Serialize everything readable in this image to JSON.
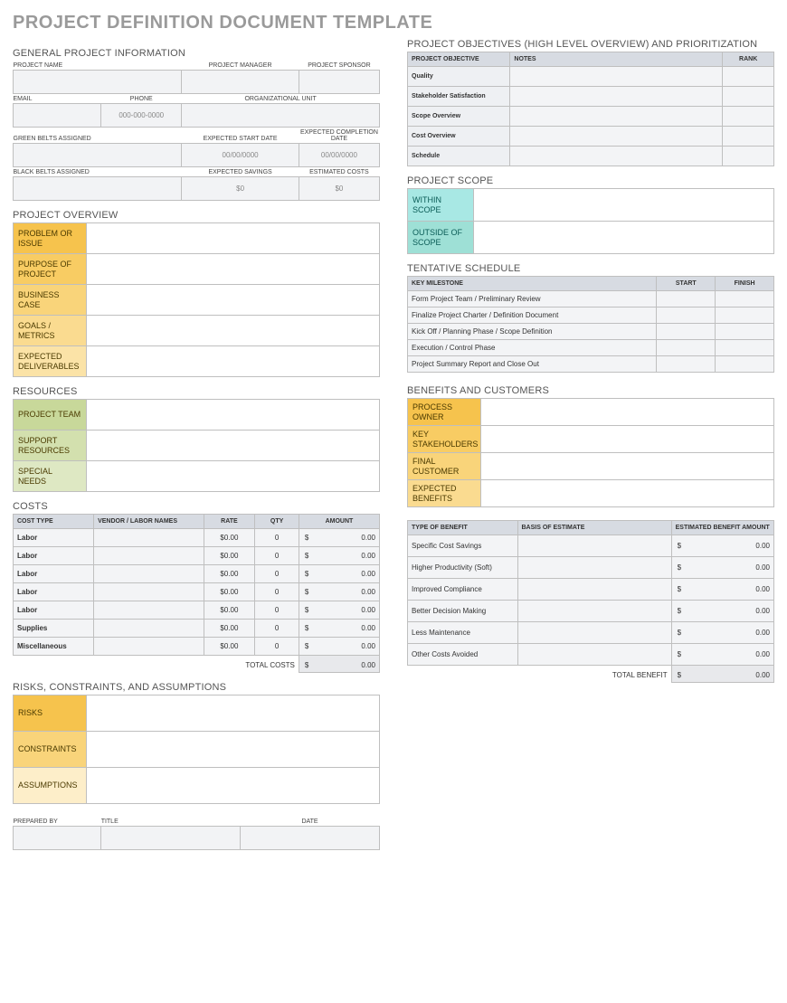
{
  "title": "PROJECT DEFINITION DOCUMENT TEMPLATE",
  "left": {
    "general": {
      "heading": "GENERAL PROJECT INFORMATION",
      "labels": {
        "project_name": "PROJECT NAME",
        "project_manager": "PROJECT MANAGER",
        "project_sponsor": "PROJECT SPONSOR",
        "email": "EMAIL",
        "phone": "PHONE",
        "org_unit": "ORGANIZATIONAL UNIT",
        "green_belts": "GREEN BELTS ASSIGNED",
        "exp_start": "EXPECTED START DATE",
        "exp_end": "EXPECTED COMPLETION DATE",
        "black_belts": "BLACK BELTS ASSIGNED",
        "exp_savings": "EXPECTED SAVINGS",
        "est_costs": "ESTIMATED COSTS"
      },
      "placeholders": {
        "phone": "000-000-0000",
        "date": "00/00/0000",
        "money": "$0"
      }
    },
    "overview": {
      "heading": "PROJECT OVERVIEW",
      "rows": [
        "PROBLEM OR ISSUE",
        "PURPOSE OF PROJECT",
        "BUSINESS CASE",
        "GOALS / METRICS",
        "EXPECTED DELIVERABLES"
      ]
    },
    "resources": {
      "heading": "RESOURCES",
      "rows": [
        "PROJECT TEAM",
        "SUPPORT RESOURCES",
        "SPECIAL NEEDS"
      ]
    },
    "costs": {
      "heading": "COSTS",
      "headers": [
        "COST TYPE",
        "VENDOR / LABOR NAMES",
        "RATE",
        "QTY",
        "AMOUNT"
      ],
      "rows": [
        {
          "type": "Labor",
          "rate": "$0.00",
          "qty": "0",
          "amt": "0.00"
        },
        {
          "type": "Labor",
          "rate": "$0.00",
          "qty": "0",
          "amt": "0.00"
        },
        {
          "type": "Labor",
          "rate": "$0.00",
          "qty": "0",
          "amt": "0.00"
        },
        {
          "type": "Labor",
          "rate": "$0.00",
          "qty": "0",
          "amt": "0.00"
        },
        {
          "type": "Labor",
          "rate": "$0.00",
          "qty": "0",
          "amt": "0.00"
        },
        {
          "type": "Supplies",
          "rate": "$0.00",
          "qty": "0",
          "amt": "0.00"
        },
        {
          "type": "Miscellaneous",
          "rate": "$0.00",
          "qty": "0",
          "amt": "0.00"
        }
      ],
      "total_label": "TOTAL COSTS",
      "total": "0.00",
      "cur": "$"
    },
    "risks": {
      "heading": "RISKS, CONSTRAINTS, AND ASSUMPTIONS",
      "rows": [
        "RISKS",
        "CONSTRAINTS",
        "ASSUMPTIONS"
      ]
    },
    "footer": {
      "labels": {
        "prepared": "PREPARED BY",
        "title": "TITLE",
        "date": "DATE"
      }
    }
  },
  "right": {
    "objectives": {
      "heading": "PROJECT OBJECTIVES (HIGH LEVEL OVERVIEW) AND PRIORITIZATION",
      "headers": [
        "PROJECT OBJECTIVE",
        "NOTES",
        "RANK"
      ],
      "rows": [
        "Quality",
        "Stakeholder Satisfaction",
        "Scope Overview",
        "Cost Overview",
        "Schedule"
      ]
    },
    "scope": {
      "heading": "PROJECT SCOPE",
      "rows": [
        "WITHIN SCOPE",
        "OUTSIDE OF SCOPE"
      ]
    },
    "schedule": {
      "heading": "TENTATIVE SCHEDULE",
      "headers": [
        "KEY MILESTONE",
        "START",
        "FINISH"
      ],
      "rows": [
        "Form Project Team / Preliminary Review",
        "Finalize Project Charter / Definition Document",
        "Kick Off / Planning Phase / Scope Definition",
        "Execution / Control Phase",
        "Project Summary Report and Close Out"
      ]
    },
    "benefits": {
      "heading": "BENEFITS AND CUSTOMERS",
      "top_rows": [
        "PROCESS OWNER",
        "KEY STAKEHOLDERS",
        "FINAL CUSTOMER",
        "EXPECTED BENEFITS"
      ],
      "headers": [
        "TYPE OF BENEFIT",
        "BASIS OF ESTIMATE",
        "ESTIMATED BENEFIT AMOUNT"
      ],
      "rows": [
        {
          "type": "Specific Cost Savings",
          "amt": "0.00"
        },
        {
          "type": "Higher Productivity (Soft)",
          "amt": "0.00"
        },
        {
          "type": "Improved Compliance",
          "amt": "0.00"
        },
        {
          "type": "Better Decision Making",
          "amt": "0.00"
        },
        {
          "type": "Less Maintenance",
          "amt": "0.00"
        },
        {
          "type": "Other Costs Avoided",
          "amt": "0.00"
        }
      ],
      "total_label": "TOTAL BENEFIT",
      "total": "0.00",
      "cur": "$"
    }
  }
}
